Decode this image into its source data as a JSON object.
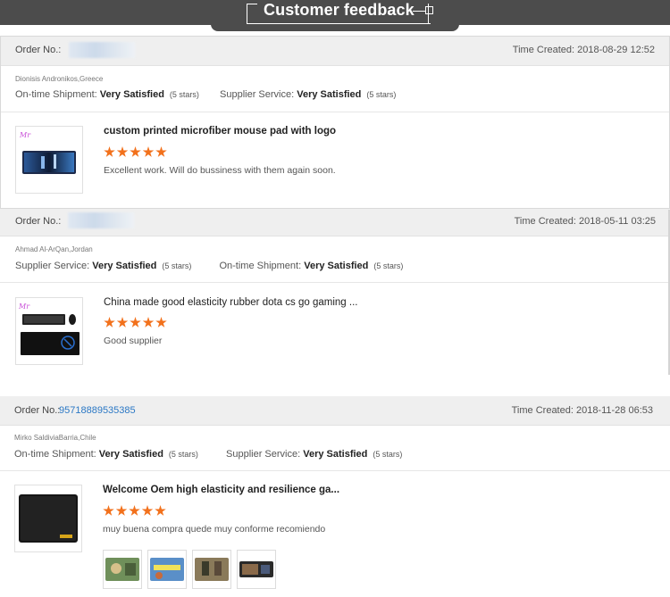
{
  "header": {
    "title": "Customer feedback"
  },
  "feedback": [
    {
      "order_label": "Order No.:",
      "order_number": "",
      "time_created": "Time Created: 2018-08-29 12:52",
      "buyer": "Dionisis Andronikos,Greece",
      "ratings": [
        {
          "label": "On-time Shipment:",
          "value": "Very Satisfied",
          "stars": "(5 stars)"
        },
        {
          "label": "Supplier Service:",
          "value": "Very Satisfied",
          "stars": "(5 stars)"
        }
      ],
      "product_title": "custom printed microfiber mouse pad with logo",
      "rating_stars": 5,
      "comment": "Excellent work. Will do bussiness with them again soon."
    },
    {
      "order_label": "Order No.:",
      "order_number": "",
      "time_created": "Time Created: 2018-05-11 03:25",
      "buyer": "Ahmad Al-ArQan,Jordan",
      "ratings": [
        {
          "label": "Supplier Service:",
          "value": "Very Satisfied",
          "stars": "(5 stars)"
        },
        {
          "label": "On-time Shipment:",
          "value": "Very Satisfied",
          "stars": "(5 stars)"
        }
      ],
      "product_title": "China made good elasticity rubber dota cs go gaming ...",
      "rating_stars": 5,
      "comment": "Good supplier"
    },
    {
      "order_label": "Order No.:",
      "order_number": "95718889535385",
      "time_created": "Time Created: 2018-11-28 06:53",
      "buyer": "Mirko SaldiviaBarria,Chile",
      "ratings": [
        {
          "label": "On-time Shipment:",
          "value": "Very Satisfied",
          "stars": "(5 stars)"
        },
        {
          "label": "Supplier Service:",
          "value": "Very Satisfied",
          "stars": "(5 stars)"
        }
      ],
      "product_title": "Welcome Oem high elasticity and resilience ga...",
      "rating_stars": 5,
      "comment": "muy buena compra quede muy conforme recomiendo"
    }
  ],
  "colors": {
    "star": "#f2711c",
    "link": "#2b78c5",
    "header_bg": "#4c4c4c"
  }
}
